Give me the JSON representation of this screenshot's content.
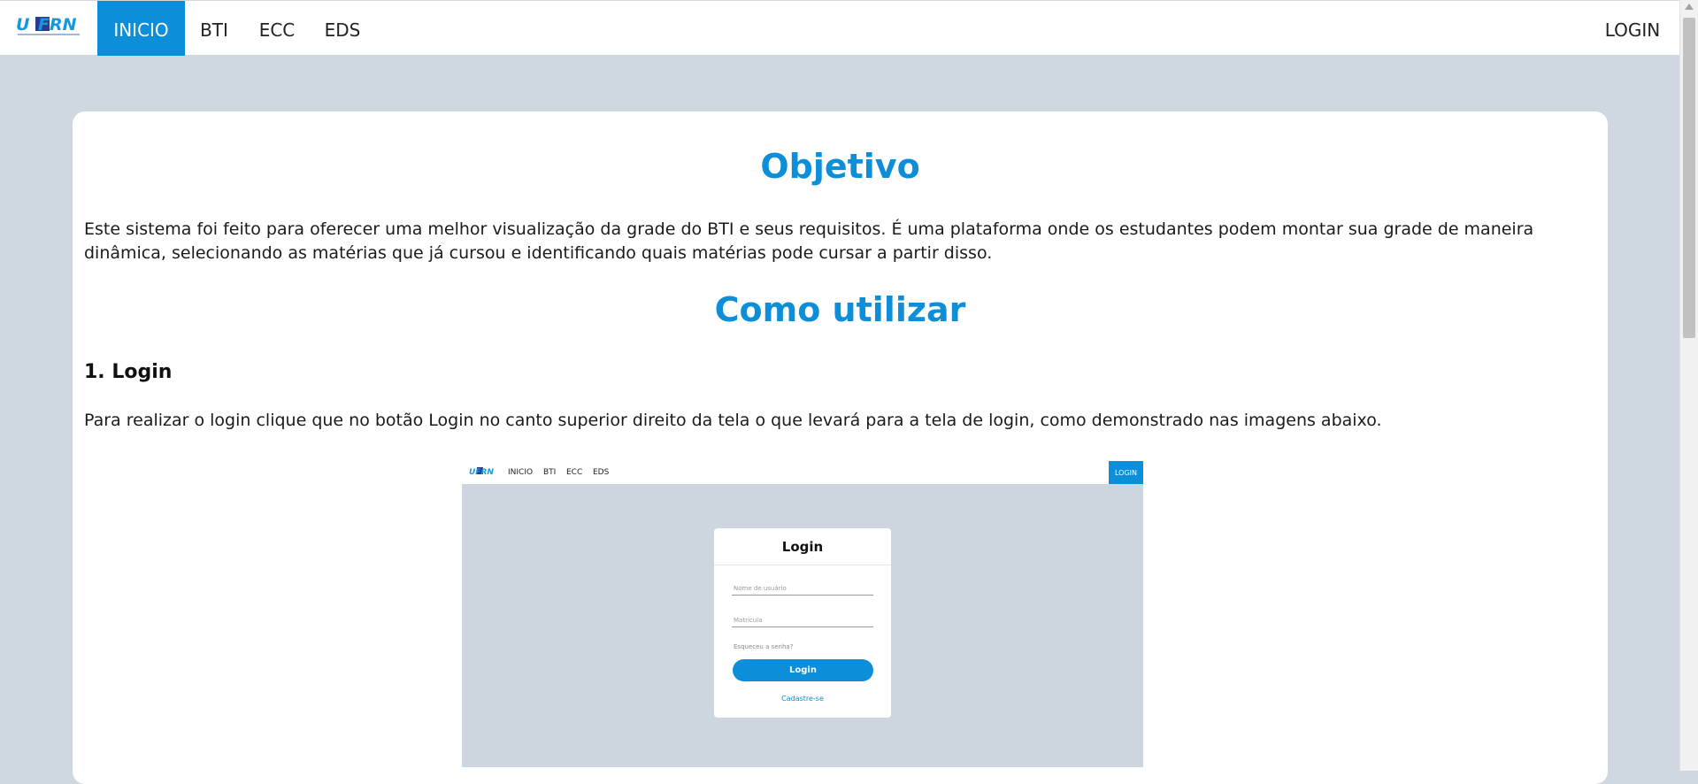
{
  "navbar": {
    "logo_text": "UFRN",
    "items": [
      {
        "label": "INICIO",
        "active": true
      },
      {
        "label": "BTI",
        "active": false
      },
      {
        "label": "ECC",
        "active": false
      },
      {
        "label": "EDS",
        "active": false
      }
    ],
    "login_label": "LOGIN"
  },
  "content": {
    "objective_title": "Objetivo",
    "objective_text": "Este sistema foi feito para oferecer uma melhor visualização da grade do BTI e seus requisitos. É uma plataforma onde os estudantes podem montar sua grade de maneira dinâmica, selecionando as matérias que já cursou e identificando quais matérias pode cursar a partir disso.",
    "howto_title": "Como utilizar",
    "step1_title": "1. Login",
    "step1_text": "Para realizar o login clique que no botão Login no canto superior direito da tela o que levará para a tela de login, como demonstrado nas imagens abaixo."
  },
  "screenshot": {
    "nav_items": [
      "INICIO",
      "BTI",
      "ECC",
      "EDS"
    ],
    "nav_login": "LOGIN",
    "box_title": "Login",
    "username_placeholder": "Nome de usuário",
    "matricula_placeholder": "Matrícula",
    "forgot_text": "Esqueceu a senha?",
    "login_button": "Login",
    "register_link": "Cadastre-se"
  },
  "colors": {
    "accent": "#0c8fd8",
    "page_background": "#cfd7e0",
    "card_background": "#ffffff"
  }
}
